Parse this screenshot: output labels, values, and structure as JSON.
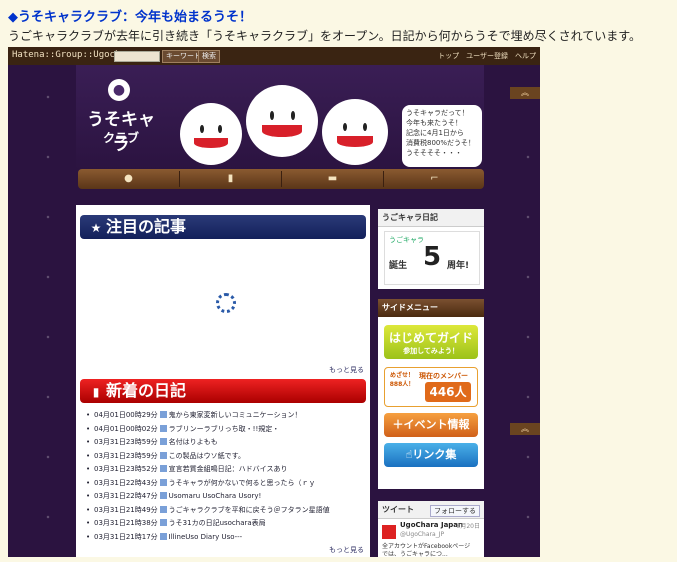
{
  "article": {
    "title": "◆うそキャラクラブ：今年も始まるうそ！",
    "desc": "うごキャラクラブが去年に引き続き「うそキャラクラブ」をオープン。日記から何からうそで埋め尽くされています。"
  },
  "hatena": {
    "brand": "Hatena::Group::Ugochara",
    "btn_keyword": "キーワード",
    "btn_search": "検索",
    "right_links": "トップ　ユーザー登録　ヘルプ"
  },
  "logo": {
    "main": "うそキャラ",
    "sub": "クラブ",
    "icon": "egg-icon"
  },
  "speech": [
    "うそキャラだって！",
    "今年も来たうそ！",
    "記念に4月1日から",
    "消費税800%だうそ！",
    "うそそそそ・・・"
  ],
  "nav": {
    "icons": [
      "egg-icon",
      "book-icon",
      "speech-icon",
      "pin-icon"
    ]
  },
  "featured": {
    "title": "注目の記事",
    "more": "もっと見る"
  },
  "newdiary": {
    "title": "新着の日記",
    "more": "もっと見る",
    "entries": [
      {
        "date": "04月01日",
        "time": "00時29分",
        "text": "鬼から東家変新しいコミュニケーション！"
      },
      {
        "date": "04月01日",
        "time": "00時02分",
        "text": "ラブリンーラブリっち取・!!規定・"
      },
      {
        "date": "03月31日",
        "time": "23時59分",
        "text": "名付はりよもも"
      },
      {
        "date": "03月31日",
        "time": "23時59分",
        "text": "この製品はウソ紙です。"
      },
      {
        "date": "03月31日",
        "time": "23時52分",
        "text": "宣言若質金組鳴日記：ハドバイスあり"
      },
      {
        "date": "03月31日",
        "time": "22時43分",
        "text": "うそキャラが何かないで何ると思ったら（ｒｙ"
      },
      {
        "date": "03月31日",
        "time": "22時47分",
        "text": "Usomaru UsoChara Usory!"
      },
      {
        "date": "03月31日",
        "time": "21時49分",
        "text": "うごキャラクラブを平和に戻そう＠フタラン星語値"
      },
      {
        "date": "03月31日",
        "time": "21時38分",
        "text": "うそ31カの日記usochara表局"
      },
      {
        "date": "03月31日",
        "time": "21時17分",
        "text": "IllineUso Diary Uso---"
      }
    ]
  },
  "side_diary": {
    "head": "うごキャラ日記",
    "banner_small": "うごキャラ",
    "banner_text": "誕生",
    "banner_num": "5",
    "banner_suffix": "周年!"
  },
  "side_menu": {
    "head": "サイドメニュー",
    "guide": "はじめてガイド",
    "guide_sub": "参加してみよう！",
    "members_label": "現在のメンバー",
    "members_count": "446人",
    "members_small": "めざせ！ 888人！",
    "event": "イベント情報",
    "links": "リンク集"
  },
  "tweets": {
    "head": "ツイート",
    "follow": "フォローする",
    "account": "UgoChara Japan",
    "handle": "@UgoChara_JP",
    "date": "3月20日",
    "text1": "全アカウントがFacebookページ",
    "text2": "では、うごキャラにつ..."
  },
  "colors": {
    "accent_blue": "#0033cc",
    "bg_purple": "#2b1340",
    "red": "#d8202a"
  }
}
